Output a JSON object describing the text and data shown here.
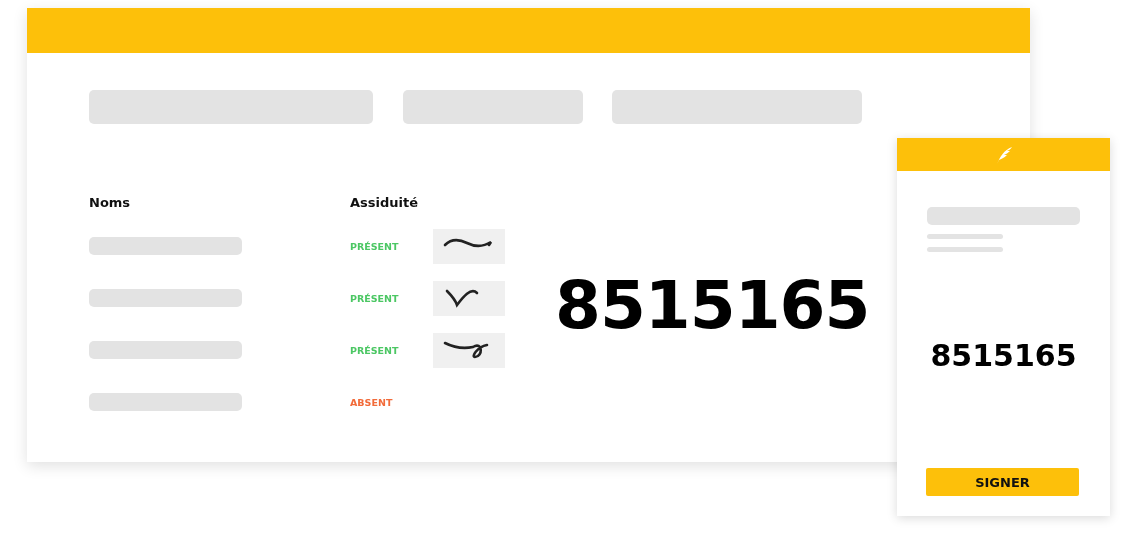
{
  "window": {
    "columns": [
      "Noms",
      "Assiduité"
    ],
    "rows": [
      {
        "status": "PRÉSENT",
        "color": "#4cc764",
        "signed": true
      },
      {
        "status": "PRÉSENT",
        "color": "#4cc764",
        "signed": true
      },
      {
        "status": "PRÉSENT",
        "color": "#4cc764",
        "signed": true
      },
      {
        "status": "ABSENT",
        "color": "#f26b3a",
        "signed": false
      }
    ],
    "code": "8515165"
  },
  "phone": {
    "code": "8515165",
    "button": "SIGNER"
  }
}
